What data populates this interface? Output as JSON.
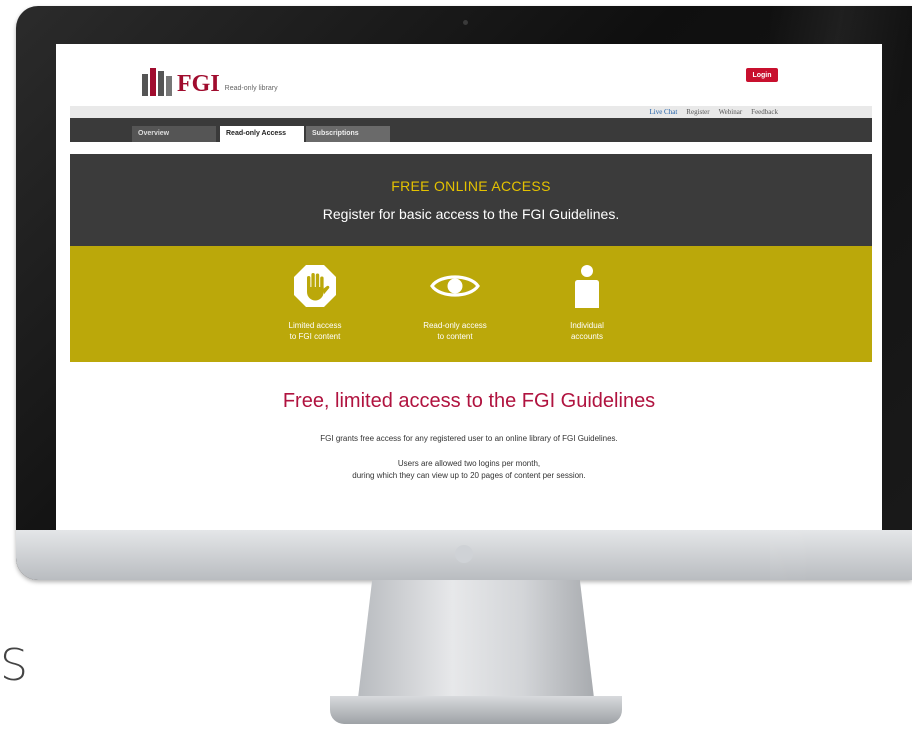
{
  "brand": {
    "logo_text": "FGI",
    "logo_sub": "Read-only library",
    "accent": "#a00c2e"
  },
  "header": {
    "login_label": "Login"
  },
  "util_links": [
    "Live Chat",
    "Register",
    "Webinar",
    "Feedback"
  ],
  "tabs": [
    {
      "label": "Overview",
      "active": false
    },
    {
      "label": "Read-only Access",
      "active": true
    },
    {
      "label": "Subscriptions",
      "active": false
    }
  ],
  "hero": {
    "kicker": "FREE ONLINE ACCESS",
    "title": "Register for basic access to the FGI Guidelines."
  },
  "features": [
    {
      "icon": "hand-stop-icon",
      "line1": "Limited access",
      "line2": "to FGI content"
    },
    {
      "icon": "eye-icon",
      "line1": "Read-only access",
      "line2": "to content"
    },
    {
      "icon": "person-icon",
      "line1": "Individual",
      "line2": "accounts"
    }
  ],
  "main": {
    "heading": "Free, limited access to the FGI Guidelines",
    "p1": "FGI grants free access for any registered user to an online library of FGI Guidelines.",
    "p2_line1": "Users are allowed two logins per month,",
    "p2_line2": "during which they can view up to 20 pages of content per session."
  },
  "edge_glyph": "S",
  "colors": {
    "hero_bg": "#3b3b3b",
    "features_bg": "#bba80a",
    "kicker": "#e4c200",
    "heading": "#b0133f",
    "login_bg": "#c8102e",
    "live_chat": "#1f5fa8"
  }
}
